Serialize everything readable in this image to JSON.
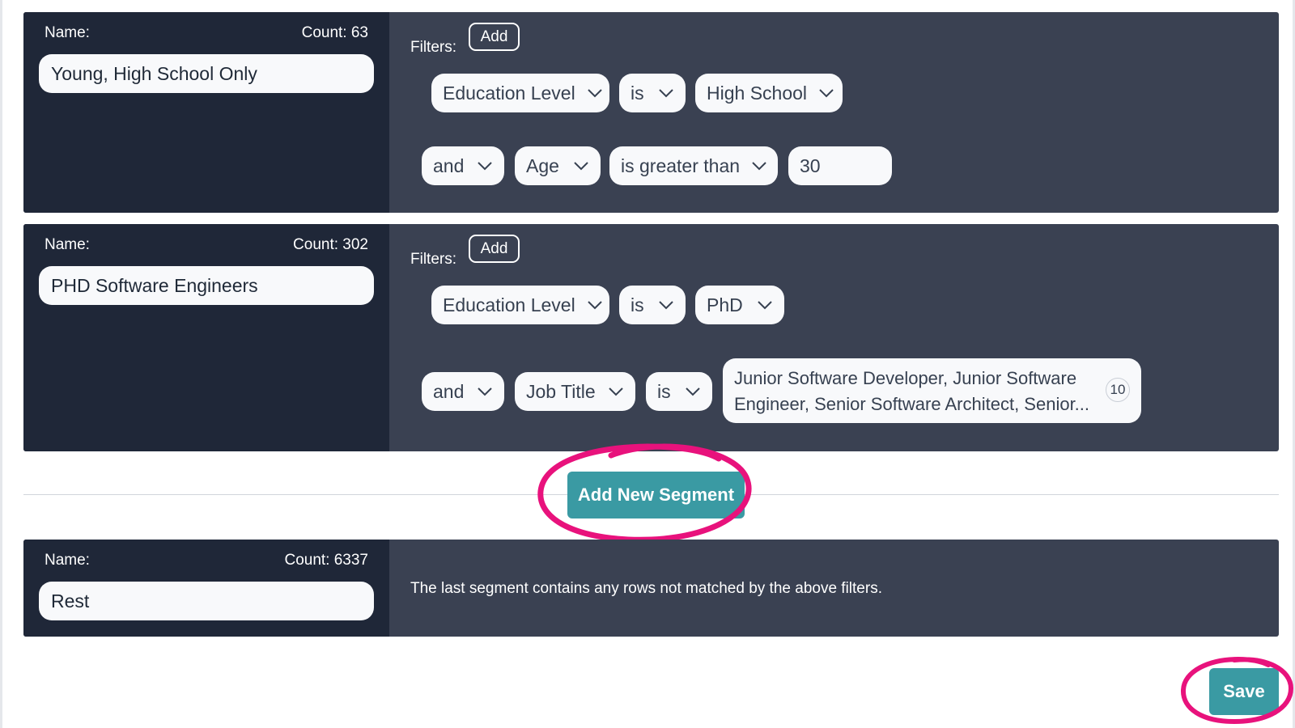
{
  "segments": [
    {
      "name_label": "Name:",
      "count_label": "Count: 63",
      "name_value": "Young, High School Only",
      "filters_label": "Filters:",
      "add_label": "Add",
      "filter_rows": [
        [
          "Education Level",
          "is",
          "High School"
        ],
        [
          "and",
          "Age",
          "is greater than",
          "30"
        ]
      ]
    },
    {
      "name_label": "Name:",
      "count_label": "Count: 302",
      "name_value": "PHD Software Engineers",
      "filters_label": "Filters:",
      "add_label": "Add",
      "filter_rows": [
        [
          "Education Level",
          "is",
          "PhD"
        ],
        [
          "and",
          "Job Title",
          "is",
          "Junior Software Developer, Junior Software Engineer, Senior Software Architect, Senior..."
        ]
      ],
      "multi_count": "10"
    }
  ],
  "add_segment_label": "Add New Segment",
  "rest": {
    "name_label": "Name:",
    "count_label": "Count: 6337",
    "name_value": "Rest",
    "description": "The last segment contains any rows not matched by the above filters."
  },
  "save_label": "Save",
  "colors": {
    "segment_bg": "#3a4152",
    "name_panel_bg": "#1f2738",
    "button_teal": "#3a9aa3",
    "annotation_pink": "#e8127c"
  },
  "icons": {
    "dropdown": "chevron-down-icon",
    "annotation": "hand-drawn-circle"
  }
}
